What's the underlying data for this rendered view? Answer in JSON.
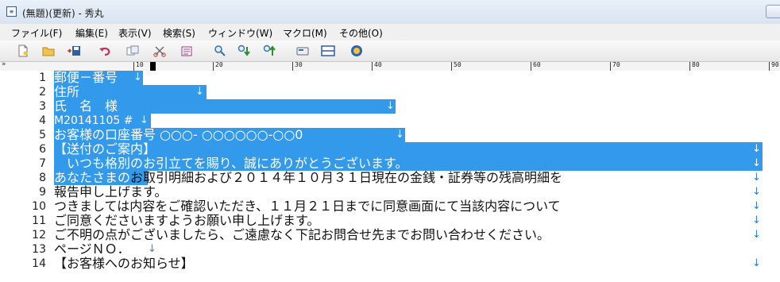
{
  "window": {
    "title": "(無題)(更新) - 秀丸",
    "icon_glyph": "≡"
  },
  "menu": [
    "ファイル(F)",
    "編集(E)",
    "表示(V)",
    "検索(S)",
    "ウィンドウ(W)",
    "マクロ(M)",
    "その他(O)"
  ],
  "toolbar_icons": [
    "new-file-icon",
    "open-folder-icon",
    "save-icon",
    "undo-icon",
    "copy-icon",
    "cut-icon",
    "paste-icon",
    "find-icon",
    "find-down-icon",
    "find-up-icon",
    "grep-icon",
    "window-split-icon",
    "help-icon"
  ],
  "ruler": {
    "start_glyph": "»",
    "labels": [
      "10",
      "20",
      "30",
      "40",
      "50",
      "60",
      "70",
      "80",
      "90"
    ]
  },
  "newline_glyph": "↓",
  "colors": {
    "selection": "#3399ea",
    "newline_mark": "#3a7fd0",
    "title_bar": "#dce7f3"
  },
  "lines": [
    {
      "num": "1",
      "sel": "郵便－番号",
      "rest": ""
    },
    {
      "num": "2",
      "sel": "住所",
      "rest": ""
    },
    {
      "num": "3",
      "sel": "氏　名　様",
      "rest": ""
    },
    {
      "num": "4",
      "sel": "M20141105 #",
      "rest": ""
    },
    {
      "num": "5",
      "sel": "お客様の口座番号 ○○○- ○○○○○○-○○0",
      "rest": ""
    },
    {
      "num": "6",
      "sel": "【送付のご案内】",
      "rest": ""
    },
    {
      "num": "7",
      "sel": "　いつも格別のお引立てを賜り、誠にありがとうございます。",
      "rest": ""
    },
    {
      "num": "8",
      "sel": "あなたさまの",
      "rest": "お取引明細および２０１４年１０月３１日現在の金銭・証券等の残高明細を"
    },
    {
      "num": "9",
      "sel": "",
      "rest": "報告申し上げます。"
    },
    {
      "num": "10",
      "sel": "",
      "rest": "つきましては内容をご確認いただき、１１月２１日までに同意画面にて当該内容について"
    },
    {
      "num": "11",
      "sel": "",
      "rest": "ご同意くださいますようお願い申し上げます。"
    },
    {
      "num": "12",
      "sel": "",
      "rest": "ご不明の点がございましたら、ご遠慮なく下記お問合せ先までお問い合わせください。"
    },
    {
      "num": "13",
      "sel": "",
      "rest": "ページＮＯ．"
    },
    {
      "num": "14",
      "sel": "",
      "rest": "【お客様へのお知らせ】"
    }
  ]
}
